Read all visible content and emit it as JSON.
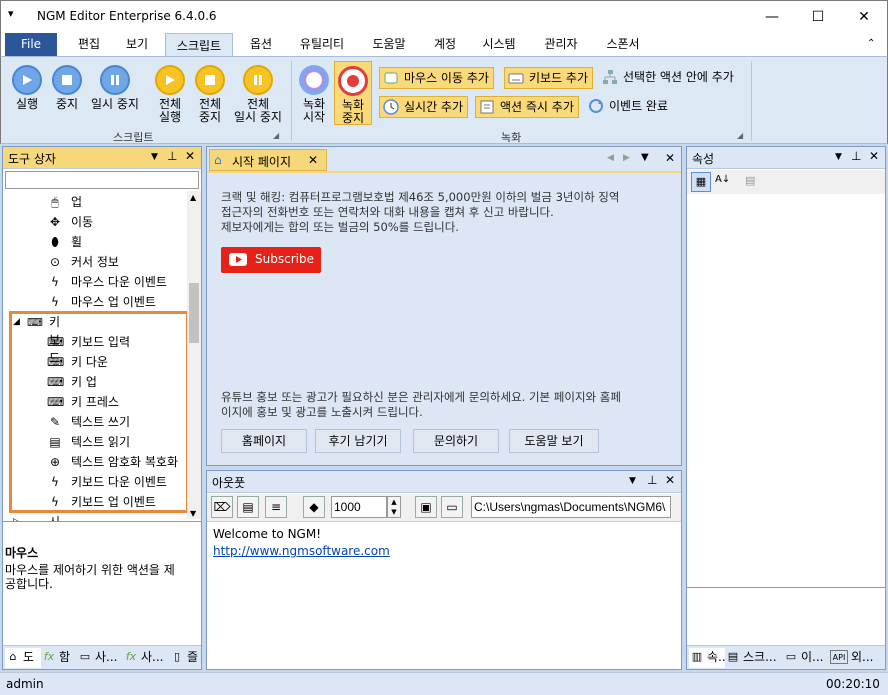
{
  "window": {
    "title": "NGM Editor",
    "version": "Enterprise 6.4.0.6",
    "minimize": "—",
    "maximize": "☐",
    "close": "✕",
    "quick_access": "▾"
  },
  "tabs": [
    "File",
    "편집",
    "보기",
    "스크립트",
    "옵션",
    "유틸리티",
    "도움말",
    "계정",
    "시스템",
    "관리자",
    "스폰서"
  ],
  "ribbon": {
    "script": {
      "run": "실행",
      "stop": "중지",
      "pause": "일시 중지",
      "run_all_1": "전체",
      "run_all_2": "실행",
      "stop_all_1": "전체",
      "stop_all_2": "중지",
      "pause_all_1": "전체",
      "pause_all_2": "일시 중지",
      "group": "스크립트"
    },
    "record": {
      "start_1": "녹화",
      "start_2": "시작",
      "stop_1": "녹화",
      "stop_2": "중지",
      "add_mouse_move": "마우스 이동 추가",
      "add_keyboard": "키보드 추가",
      "add_after_selected": "선택한 액션 안에 추가",
      "add_realtime": "실시간 추가",
      "add_action_now": "액션 즉시 추가",
      "event_complete": "이벤트 완료",
      "group": "녹화"
    }
  },
  "toolbox": {
    "title": "도구 상자",
    "search_placeholder": "",
    "items": [
      {
        "icon": "mouse-icon",
        "label": "업"
      },
      {
        "icon": "move-icon",
        "label": "이동"
      },
      {
        "icon": "wheel-icon",
        "label": "휠"
      },
      {
        "icon": "cursor-info-icon",
        "label": "커서 정보"
      },
      {
        "icon": "bolt-icon",
        "label": "마우스 다운 이벤트"
      },
      {
        "icon": "bolt-icon",
        "label": "마우스 업 이벤트"
      }
    ],
    "keyboard_group": "키보드",
    "keyboard_items": [
      {
        "icon": "keyboard-icon",
        "label": "키보드 입력"
      },
      {
        "icon": "key-down-icon",
        "label": "키 다운"
      },
      {
        "icon": "key-up-icon",
        "label": "키 업"
      },
      {
        "icon": "key-press-icon",
        "label": "키 프레스"
      },
      {
        "icon": "text-write-icon",
        "label": "텍스트 쓰기"
      },
      {
        "icon": "text-read-icon",
        "label": "텍스트 읽기"
      },
      {
        "icon": "encrypt-icon",
        "label": "텍스트 암호화 복호화"
      },
      {
        "icon": "bolt-icon",
        "label": "키보드 다운 이벤트"
      },
      {
        "icon": "bolt-icon",
        "label": "키보드 업 이벤트"
      }
    ],
    "time_group": "시간",
    "desc_title": "마우스",
    "desc_text_1": "마우스를 제어하기 위한 액션을 제",
    "desc_text_2": "공합니다.",
    "bottom_tabs": [
      "도",
      "함",
      "사...",
      "사...",
      "즐"
    ]
  },
  "start_page": {
    "tab": "시작 페이지",
    "notice_1": "크랙 및 해킹: 컴퓨터프로그램보호법 제46조 5,000만원 이하의 벌금 3년이하 징역",
    "notice_2": "접근자의 전화번호 또는 연락처와 대화 내용을 캡쳐 후 신고 바랍니다.",
    "notice_3": "제보자에게는 합의 또는 벌금의 50%를 드립니다.",
    "subscribe": "Subscribe",
    "promo_1": "유튜브 홍보 또는 광고가 필요하신 분은 관리자에게 문의하세요. 기본 페이지와 홈페",
    "promo_2": "이지에 홍보 및 광고를 노출시켜 드립니다.",
    "buttons": [
      "홈페이지",
      "후기 남기기",
      "문의하기",
      "도움말 보기"
    ]
  },
  "output": {
    "title": "아웃풋",
    "interval": "1000",
    "path": "C:\\Users\\ngmas\\Documents\\NGM6\\",
    "welcome": "Welcome to NGM!",
    "url": "http://www.ngmsoftware.com"
  },
  "properties": {
    "title": "속성",
    "bottom_tabs": [
      "속...",
      "스크...",
      "이...",
      "외..."
    ]
  },
  "status": {
    "user": "admin",
    "time": "00:20:10"
  },
  "colors": {
    "accent": "#2b579a",
    "highlight": "#e8893a",
    "record": "#e43b3b"
  }
}
